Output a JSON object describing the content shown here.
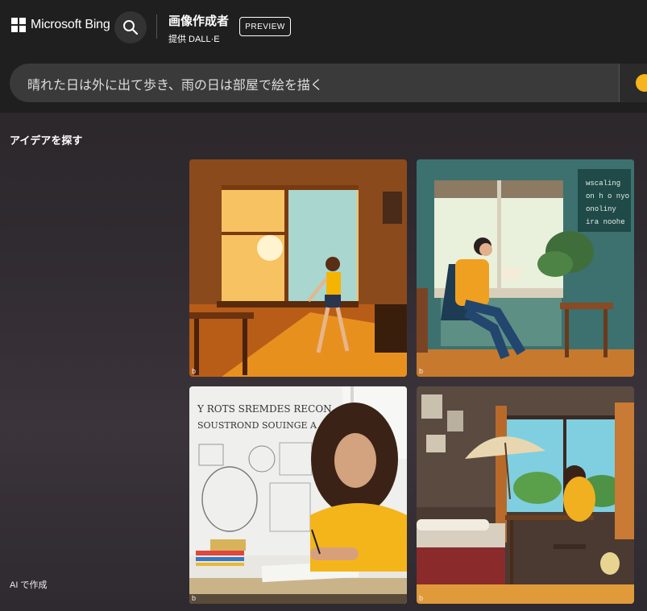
{
  "header": {
    "brand": "Microsoft Bing",
    "product_title": "画像作成者",
    "product_subtitle": "提供 DALL·E",
    "preview_badge": "PREVIEW"
  },
  "search": {
    "prompt": "晴れた日は外に出て歩き、雨の日は部屋で絵を描く"
  },
  "explore": {
    "heading": "アイデアを探す",
    "footer_note": "AI で作成"
  },
  "images": [
    {
      "watermark": "b",
      "subject": "girl-walking-sunlit-room-rain"
    },
    {
      "watermark": "b",
      "subject": "person-reading-by-window-plants"
    },
    {
      "watermark": "b",
      "subject": "curly-hair-woman-drawing-sketch-wall"
    },
    {
      "watermark": "b",
      "subject": "girl-desk-window-umbrella-bedroom"
    }
  ],
  "sketch_wall_text": [
    "Y ROTS SREMDES RECON",
    "SOUSTROND SOUINGE A"
  ],
  "chalkboard_text": [
    "wscaling",
    "on h o nyo",
    "onoliny",
    "ira noohe"
  ],
  "colors": {
    "topbar": "#1f1f1f",
    "prompt_bg": "#3a3a3a",
    "accent_coin": "#f5b51b"
  }
}
